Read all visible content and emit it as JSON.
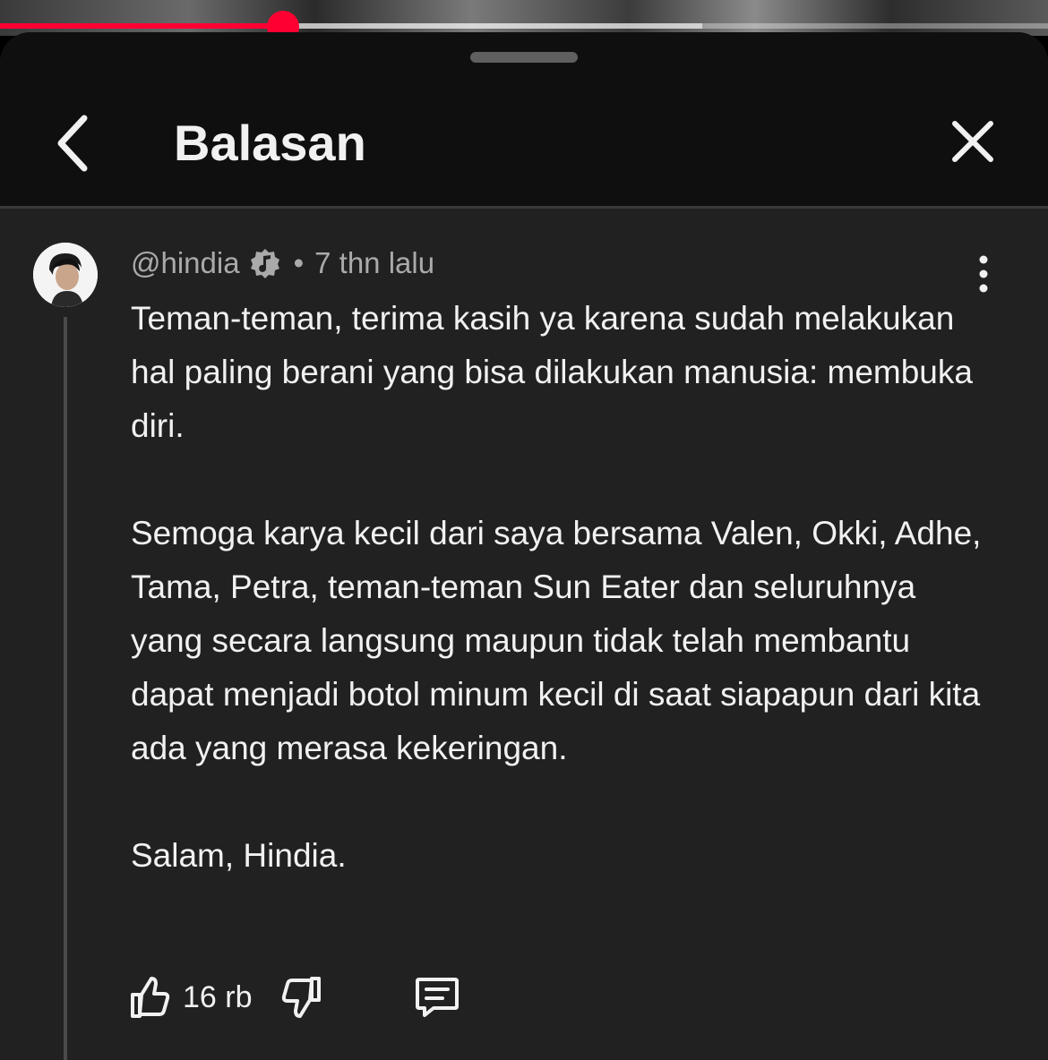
{
  "video": {
    "progress_played_fraction": 0.27,
    "progress_buffered_fraction": 0.67,
    "accent_color": "#ff0033"
  },
  "sheet": {
    "title": "Balasan",
    "back_icon": "chevron-left-icon",
    "close_icon": "close-icon",
    "handle_icon": "drag-handle"
  },
  "comment": {
    "author": "@hindia",
    "verified_icon": "music-note-badge-icon",
    "separator": "•",
    "time": "7 thn lalu",
    "more_icon": "more-vertical-icon",
    "paragraphs": [
      "Teman-teman, terima kasih ya karena sudah melakukan hal paling berani yang bisa dilakukan manusia: membuka diri.",
      "Semoga karya kecil dari saya bersama Valen, Okki, Adhe, Tama, Petra, teman-teman Sun Eater dan seluruhnya yang secara langsung maupun tidak telah membantu dapat menjadi botol minum kecil di saat siapapun dari kita ada yang merasa kekeringan.",
      "Salam, Hindia."
    ],
    "like_count": "16 rb",
    "like_icon": "thumbs-up-icon",
    "dislike_icon": "thumbs-down-icon",
    "reply_icon": "comment-icon"
  },
  "colors": {
    "background": "#212121",
    "header_background": "#0f0f0f",
    "text_primary": "#f1f1f1",
    "text_secondary": "#aaaaaa"
  }
}
